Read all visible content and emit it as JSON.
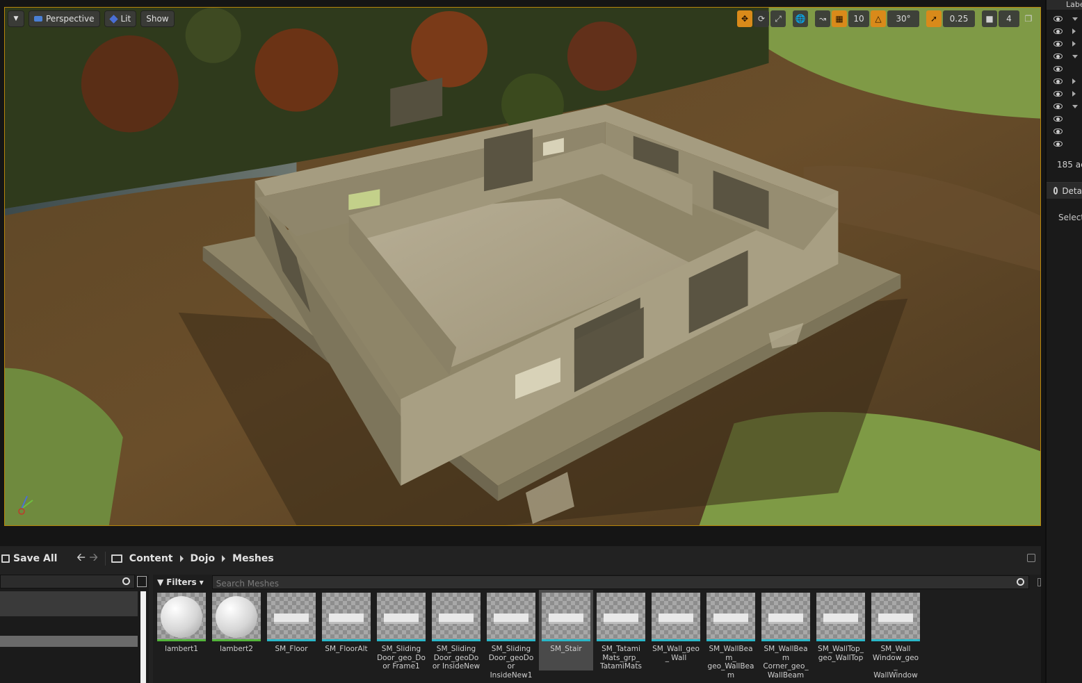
{
  "viewport": {
    "perspective_label": "Perspective",
    "lit_label": "Lit",
    "show_label": "Show",
    "grid_snap_value": "10",
    "rotation_snap_value": "30°",
    "scale_snap_value": "0.25",
    "camera_speed_value": "4"
  },
  "outliner": {
    "header_label": "Labe",
    "actor_count": "185 ac",
    "details_tab_label": "Deta",
    "select_hint": "Select"
  },
  "content_browser": {
    "save_all_label": "Save All",
    "breadcrumbs": [
      "Content",
      "Dojo",
      "Meshes"
    ],
    "filters_label": "Filters",
    "search_placeholder": "Search Meshes",
    "assets": [
      {
        "label": "lambert1",
        "kind": "material"
      },
      {
        "label": "lambert2",
        "kind": "material"
      },
      {
        "label": "SM_Floor",
        "kind": "mesh"
      },
      {
        "label": "SM_FloorAlt",
        "kind": "mesh"
      },
      {
        "label": "SM_Sliding Door_geo_Door Frame1",
        "kind": "mesh"
      },
      {
        "label": "SM_Sliding Door_geoDoor InsideNew",
        "kind": "mesh"
      },
      {
        "label": "SM_Sliding Door_geoDoor InsideNew1",
        "kind": "mesh"
      },
      {
        "label": "SM_Stair",
        "kind": "mesh",
        "selected": true
      },
      {
        "label": "SM_Tatami Mats_grp_ TatamiMats",
        "kind": "mesh"
      },
      {
        "label": "SM_Wall_geo_ Wall",
        "kind": "mesh"
      },
      {
        "label": "SM_WallBeam_ geo_WallBeam",
        "kind": "mesh"
      },
      {
        "label": "SM_WallBeam Corner_geo_ WallBeam",
        "kind": "mesh"
      },
      {
        "label": "SM_WallTop_ geo_WallTop",
        "kind": "mesh"
      },
      {
        "label": "SM_Wall Window_geo_ WallWindow",
        "kind": "mesh"
      }
    ]
  },
  "colors": {
    "viewport_border": "#b8860b",
    "accent_orange": "#d98a1a",
    "mesh_bar": "#2ab7c7",
    "material_bar": "#53b53b"
  }
}
